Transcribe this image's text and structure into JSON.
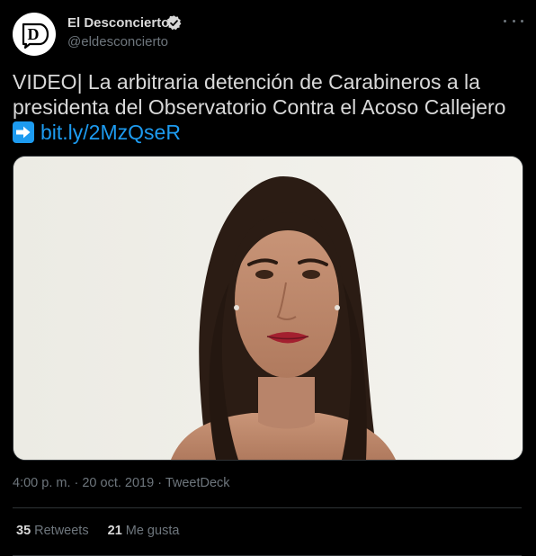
{
  "author": {
    "display_name": "El Desconcierto",
    "handle": "@eldesconcierto",
    "avatar_letter": "D",
    "avatar_icon": "el-desconcierto-logo-icon",
    "verified_icon": "verified-badge-icon"
  },
  "tweet": {
    "text_line_1": "VIDEO| La arbitraria detención de Carabineros a la",
    "text_line_2": "presidenta del Observatorio Contra el Acoso Callejero",
    "arrow_emoji": "right-arrow-emoji-icon",
    "link_text": "bit.ly/2MzQseR",
    "timestamp": "4:00 p. m. · 20 oct. 2019",
    "separator": " · ",
    "source": "TweetDeck"
  },
  "stats": {
    "retweets_count": "35",
    "retweets_label": "Retweets",
    "likes_count": "21",
    "likes_label": "Me gusta"
  },
  "colors": {
    "background": "#000000",
    "text": "#d9d9d9",
    "secondary_text": "#6e767d",
    "link": "#1d9bf0",
    "divider": "#2f3336"
  },
  "more_icon": "more-options-icon"
}
